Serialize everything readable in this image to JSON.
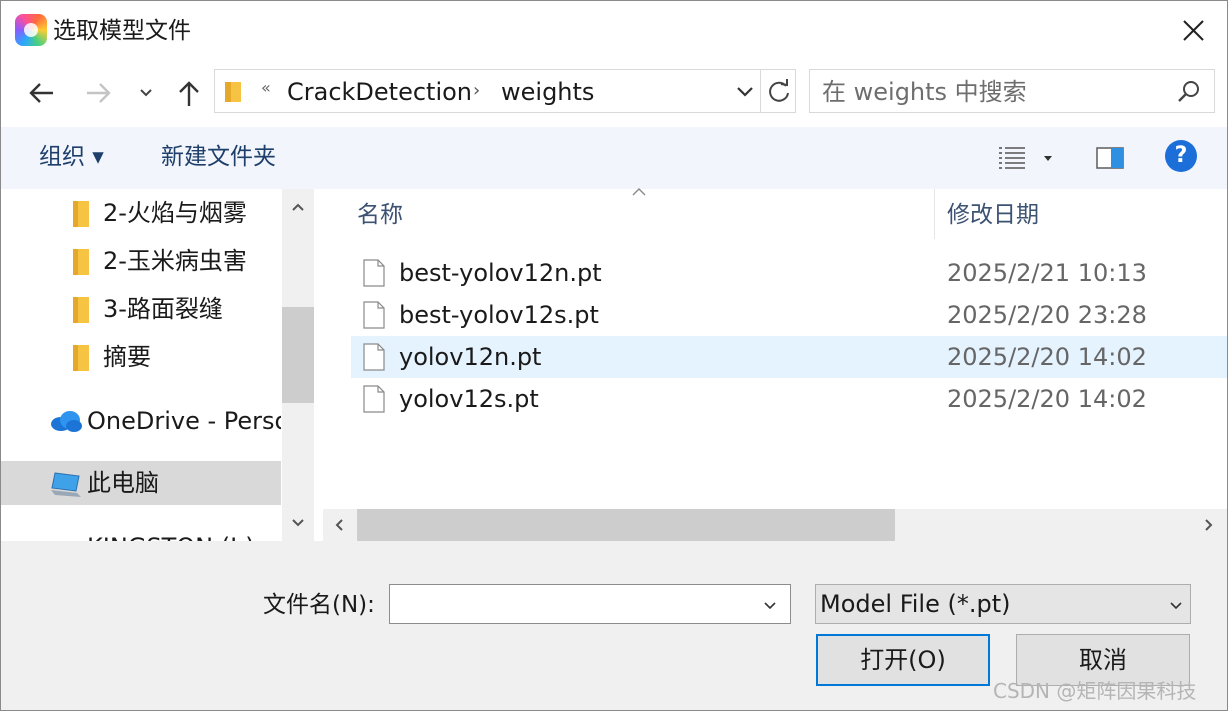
{
  "window": {
    "title": "选取模型文件"
  },
  "address": {
    "overflow_chevron": "«",
    "crumbs": [
      "CrackDetection",
      "weights"
    ],
    "separator": "›"
  },
  "search": {
    "placeholder": "在 weights 中搜索"
  },
  "toolbar": {
    "organize": "组织 ▾",
    "new_folder": "新建文件夹",
    "help": "?"
  },
  "tree": {
    "items": [
      {
        "label": "2-火焰与烟雾",
        "icon": "folder-icon"
      },
      {
        "label": "2-玉米病虫害",
        "icon": "folder-icon"
      },
      {
        "label": "3-路面裂缝",
        "icon": "folder-icon"
      },
      {
        "label": "摘要",
        "icon": "folder-icon"
      },
      {
        "label": "OneDrive - Perso",
        "icon": "cloud-icon"
      },
      {
        "label": "此电脑",
        "icon": "computer-icon",
        "selected": true
      },
      {
        "label": "KINGSTON (I:)",
        "icon": "drive-icon"
      }
    ]
  },
  "list": {
    "columns": {
      "name": "名称",
      "modified": "修改日期"
    },
    "files": [
      {
        "name": "best-yolov12n.pt",
        "modified": "2025/2/21 10:13"
      },
      {
        "name": "best-yolov12s.pt",
        "modified": "2025/2/20 23:28"
      },
      {
        "name": "yolov12n.pt",
        "modified": "2025/2/20 14:02",
        "hover": true
      },
      {
        "name": "yolov12s.pt",
        "modified": "2025/2/20 14:02"
      }
    ]
  },
  "bottom": {
    "filename_label": "文件名(N):",
    "filename_value": "",
    "file_type": "Model File (*.pt)",
    "open_button": "打开(O)",
    "cancel_button": "取消"
  },
  "watermark": "CSDN @矩阵因果科技",
  "colors": {
    "accent": "#0078d7",
    "hover_row": "#e5f3ff",
    "toolbar_bg": "#f2f5fb",
    "folder": "#f6c342"
  }
}
